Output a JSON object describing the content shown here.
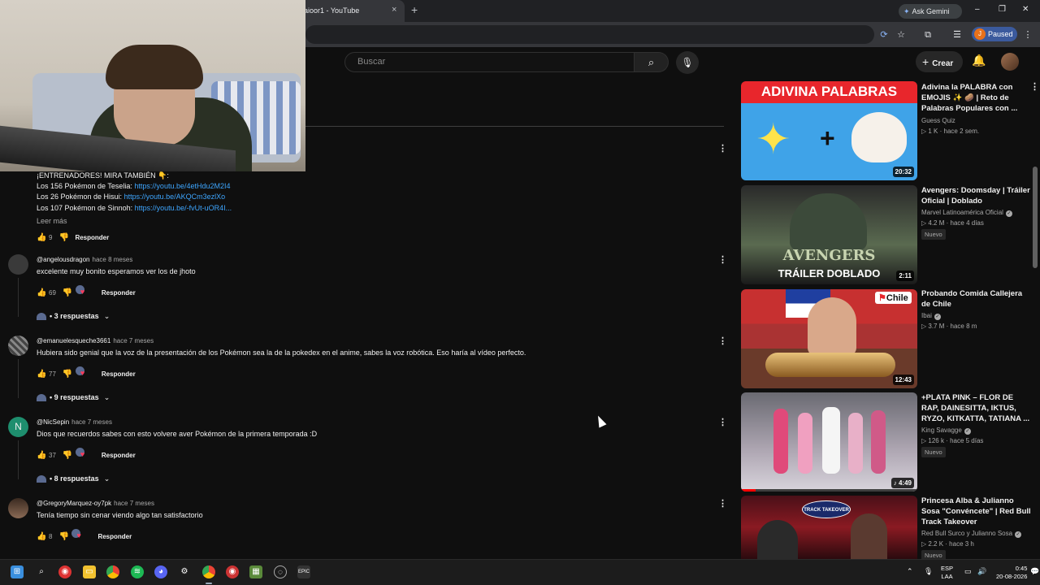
{
  "browser": {
    "tab_title": "aioor1 - YouTube",
    "tab_close": "×",
    "new_tab": "+",
    "gemini_label": "Ask Gemini",
    "profile_initial": "J",
    "profile_status": "Paused",
    "window_controls": [
      "–",
      "❐",
      "✕"
    ]
  },
  "youtube": {
    "search_placeholder": "Buscar",
    "create_label": "Crear"
  },
  "description": {
    "heading": "¡ENTRENADORES! MIRA TAMBIÉN 👇:",
    "lines": [
      {
        "text": "Los 156 Pokémon de Teselia: ",
        "link": "https://youtu.be/4etHdu2M2I4"
      },
      {
        "text": "Los 26 Pokémon de Hisui: ",
        "link": "https://youtu.be/AKQCm3ezlXo"
      },
      {
        "text": "Los 107 Pokémon de Sinnoh: ",
        "link": "https://youtu.be/-fvUt-uOR4I..."
      }
    ],
    "read_more": "Leer más",
    "likes": "9",
    "reply_label": "Responder"
  },
  "comments": [
    {
      "author": "@angelousdragon",
      "when": "hace 8 meses",
      "text": "excelente muy bonito esperamos ver los de jhoto",
      "likes": "69",
      "reply_label": "Responder",
      "replies": "3 respuestas",
      "avatar_color": "#3a3a3a"
    },
    {
      "author": "@emanuelesqueche3661",
      "when": "hace 7 meses",
      "text": "Hubiera sido genial que la voz de la presentación de los Pokémon sea la de la pokedex en el anime, sabes  la voz robótica. Eso haría al vídeo perfecto.",
      "likes": "77",
      "reply_label": "Responder",
      "replies": "9 respuestas",
      "avatar_color": "#555555"
    },
    {
      "author": "@NicSepin",
      "when": "hace 7 meses",
      "text": "Dios que recuerdos sabes con esto volvere aver Pokémon de la primera temporada :D",
      "likes": "37",
      "reply_label": "Responder",
      "replies": "8 respuestas",
      "avatar_letter": "N",
      "avatar_color": "#1e8e6e"
    },
    {
      "author": "@GregoryMarquez-oy7pk",
      "when": "hace 7 meses",
      "text": "Tenía tiempo sin cenar viendo algo tan satisfactorio",
      "likes": "8",
      "reply_label": "Responder",
      "avatar_color": "#6b4a3a"
    }
  ],
  "recommendations": [
    {
      "title": "Adivina la PALABRA con EMOJIS ✨ 🥔 | Reto de Palabras Populares con ...",
      "channel": "Guess Quiz",
      "views": "1 K",
      "age": "hace 2 sem.",
      "duration": "20:32",
      "thumb_text": "ADIVINA PALABRAS",
      "verified": false,
      "badge": ""
    },
    {
      "title": "Avengers: Doomsday | Tráiler Oficial | Doblado",
      "channel": "Marvel Latinoamérica Oficial",
      "views": "4.2 M",
      "age": "hace 4 días",
      "duration": "2:11",
      "thumb_text": "TRÁILER DOBLADO",
      "thumb_logo": "AVENGERS",
      "verified": true,
      "badge": "Nuevo"
    },
    {
      "title": "Probando Comida Callejera de Chile",
      "channel": "Ibai",
      "views": "3.7 M",
      "age": "hace 8 m",
      "duration": "12:43",
      "thumb_text": "Chile",
      "verified": true,
      "badge": ""
    },
    {
      "title": "+PLATA PINK – FLOR DE RAP, DAINESITTA, IKTUS, RYZO, KITKATTA, TATIANA ...",
      "channel": "King Savagge",
      "views": "126 k",
      "age": "hace 5 días",
      "duration": "4:49",
      "verified": true,
      "badge": "Nuevo"
    },
    {
      "title": "Princesa Alba & Julianno Sosa \"Convéncete\" | Red Bull Track Takeover",
      "channel": "Red Bull Surco y Julianno Sosa",
      "views": "2.2 K",
      "age": "hace 3 h",
      "thumb_text": "TRACK TAKEOVER",
      "verified": true,
      "badge": "Nuevo"
    }
  ],
  "taskbar": {
    "lang_top": "ESP",
    "lang_bottom": "LAA",
    "time": "0:45",
    "date": "20-08-2026",
    "apps": [
      "windows",
      "search",
      "app-red-1",
      "files",
      "chrome",
      "spotify",
      "discord",
      "settings",
      "chrome-active",
      "app-red-2",
      "minecraft",
      "app-circle",
      "epic"
    ]
  },
  "colors": {
    "background": "#0f0f0f",
    "link": "#3ea6ff",
    "accent_red": "#ff0000"
  }
}
